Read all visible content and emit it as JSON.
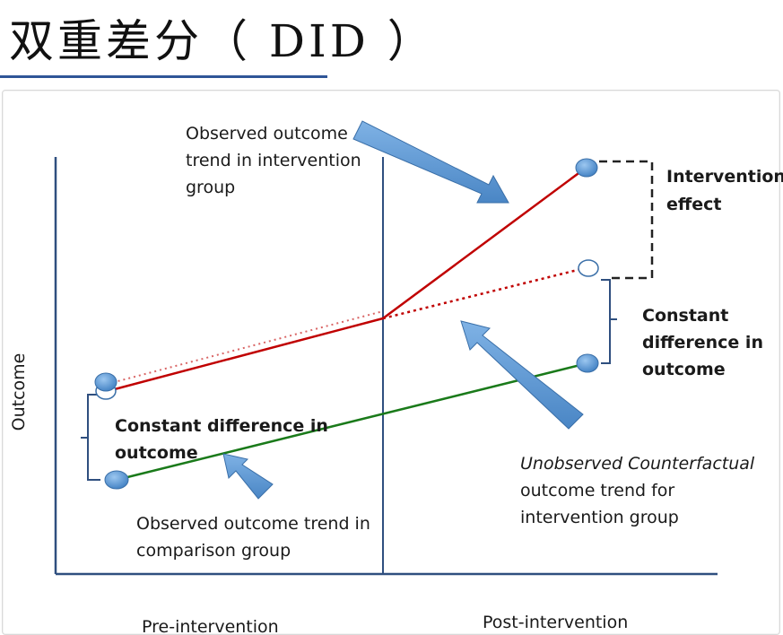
{
  "page": {
    "title": "双重差分（ DID ）"
  },
  "diagram": {
    "y_axis_label": "Outcome",
    "x_labels": {
      "pre": "Pre-intervention",
      "post": "Post-intervention"
    },
    "annotations": {
      "intervention_trend": [
        "Observed outcome",
        "trend in intervention",
        "group"
      ],
      "intervention_effect": [
        "Intervention",
        "effect"
      ],
      "constant_diff_right": [
        "Constant",
        "difference in",
        "outcome"
      ],
      "constant_diff_left": [
        "Constant difference in",
        "outcome"
      ],
      "counterfactual": [
        "Unobserved Counterfactual",
        "outcome trend for",
        "intervention group"
      ],
      "comparison_trend": [
        "Observed outcome trend in",
        "comparison group"
      ]
    },
    "colors": {
      "intervention_line": "#c00000",
      "comparison_line": "#1a7a1a",
      "axis": "#2f4f7f",
      "arrow": "#5b9bd5",
      "arrow_edge": "#3a6fa8",
      "marker": "#5b9bd5"
    }
  }
}
